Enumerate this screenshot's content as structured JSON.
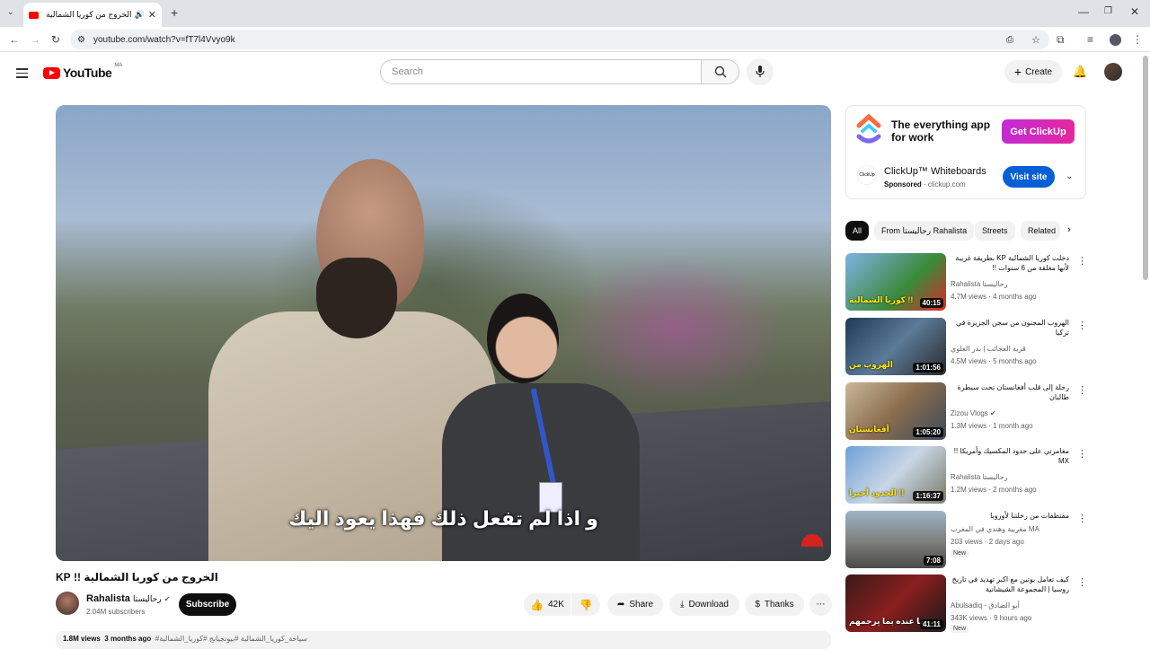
{
  "browser": {
    "tab_title": "الخروج من كوريا الشمالية !! KP",
    "url": "youtube.com/watch?v=fT7l4Vvyo9k"
  },
  "header": {
    "logo_text": "YouTube",
    "region": "MA",
    "search_placeholder": "Search",
    "create_label": "Create"
  },
  "video": {
    "subtitle": "و اذا لم تفعل ذلك فهذا يعود اليك",
    "title": "الخروج من كوريا الشمالية !! KP",
    "channel": "Rahalista",
    "channel_ar": "رحاليستا",
    "subscribers": "2.04M subscribers",
    "subscribe_label": "Subscribe",
    "likes": "42K",
    "share_label": "Share",
    "download_label": "Download",
    "thanks_label": "Thanks",
    "views": "1.8M views",
    "age": "3 months ago",
    "hashtags": "#سياحة_كوريا_الشمالية #بيونجيانج #كوريا_الشمالية"
  },
  "ad": {
    "tagline": "The everything app for work",
    "cta": "Get ClickUp",
    "logo_text": "ClickUp",
    "name": "ClickUp™ Whiteboards",
    "sponsored": "Sponsored",
    "domain": "clickup.com",
    "visit_label": "Visit site"
  },
  "chips": [
    "All",
    "From رحاليستا Rahalista",
    "Streets",
    "Related"
  ],
  "suggestions": [
    {
      "title": "دخلت كوريا الشمالية KP بطريقة غريبة لأنها مغلقة من 6 سنوات !!",
      "channel": "Rahalista رحاليستا",
      "views": "4.7M views",
      "age": "4 months ago",
      "duration": "40:15",
      "caption": "كوريا الشمالية !!",
      "badge": ""
    },
    {
      "title": "الهروب المجنون من سجن الجزيرة في تركيا",
      "channel": "قرية العجائب | بدر العلوي",
      "views": "4.5M views",
      "age": "5 months ago",
      "duration": "1:01:56",
      "caption": "الهروب من",
      "badge": ""
    },
    {
      "title": "رحلة إلى قلب أفغانستان تحت سيطرة طالبان",
      "channel": "Zizou Vlogs",
      "views": "1.3M views",
      "age": "1 month ago",
      "duration": "1:05:20",
      "caption": "أفغانستان",
      "badge": ""
    },
    {
      "title": "مغامرتي على حدود المكسيك وأمريكا !! MX",
      "channel": "Rahalista رحاليستا",
      "views": "1.2M views",
      "age": "2 months ago",
      "duration": "1:16:37",
      "caption": "الحدود أخيرا !!",
      "badge": ""
    },
    {
      "title": "مقتطفات من رحلتنا لأوروبا",
      "channel": "مغربية وهندي في المغرب MA",
      "views": "203 views",
      "age": "2 days ago",
      "duration": "7:08",
      "caption": "",
      "badge": "New"
    },
    {
      "title": "كيف تعامل بوتين مع اكبر تهديد في تاريخ روسيا | المجموعة الشيشانية",
      "channel": "Abulsadiq - أبو الصادق",
      "views": "343K views",
      "age": "9 hours ago",
      "duration": "41:11",
      "caption": "ما عنده بما يرحمهم",
      "badge": "New"
    }
  ]
}
